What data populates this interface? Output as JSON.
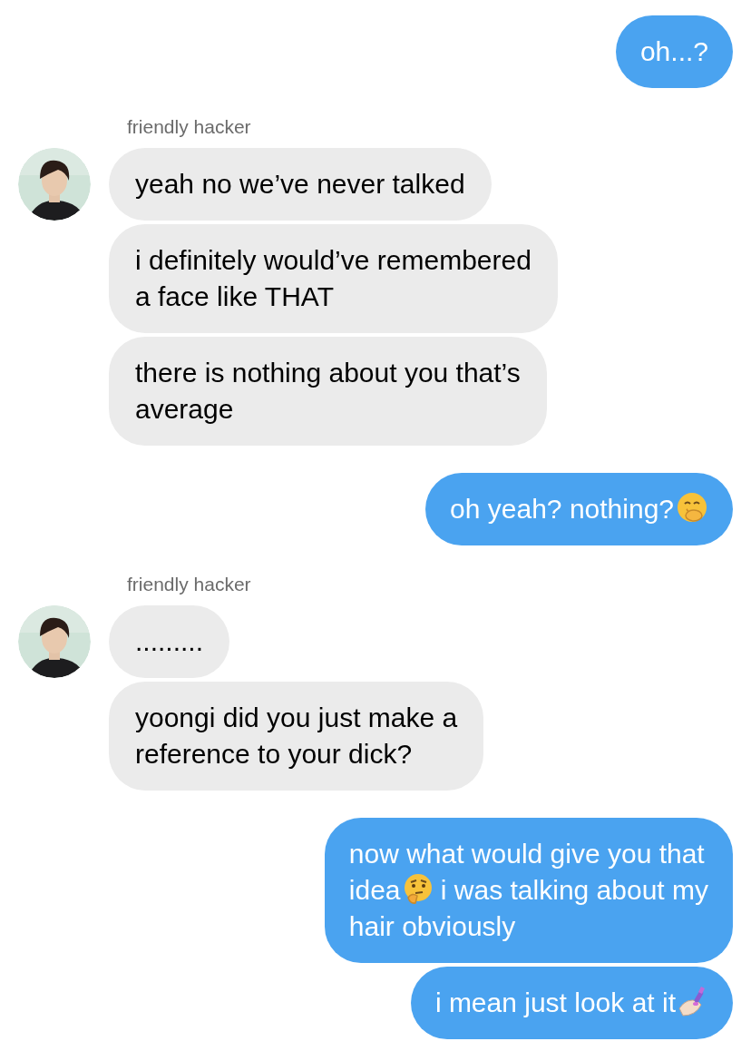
{
  "groups": [
    {
      "kind": "sent",
      "messages": [
        {
          "lines": [
            [
              {
                "kind": "text",
                "text": "oh...?"
              }
            ]
          ]
        }
      ]
    },
    {
      "kind": "received",
      "name": "friendly hacker",
      "avatar": {
        "kind": "picture"
      },
      "messages": [
        {
          "lines": [
            [
              {
                "kind": "text",
                "text": "yeah no we’ve never talked"
              }
            ]
          ]
        },
        {
          "lines": [
            [
              {
                "kind": "text",
                "text": "i definitely would’ve remembered"
              }
            ],
            [
              {
                "kind": "text",
                "text": "a face like THAT"
              }
            ]
          ]
        },
        {
          "lines": [
            [
              {
                "kind": "text",
                "text": "there is nothing about you that’s"
              }
            ],
            [
              {
                "kind": "text",
                "text": "average"
              }
            ]
          ]
        }
      ]
    },
    {
      "kind": "sent",
      "messages": [
        {
          "lines": [
            [
              {
                "kind": "text",
                "text": "oh yeah? nothing?"
              },
              {
                "kind": "giggle"
              }
            ]
          ]
        }
      ]
    },
    {
      "kind": "received",
      "name": "friendly hacker",
      "avatar": {
        "kind": "picture"
      },
      "messages": [
        {
          "lines": [
            [
              {
                "kind": "text",
                "text": "........."
              }
            ]
          ]
        },
        {
          "lines": [
            [
              {
                "kind": "text",
                "text": "yoongi did you just make a"
              }
            ],
            [
              {
                "kind": "text",
                "text": "reference to your dick?"
              }
            ]
          ]
        }
      ]
    },
    {
      "kind": "sent",
      "messages": [
        {
          "lines": [
            [
              {
                "kind": "text",
                "text": "now what would give you that"
              }
            ],
            [
              {
                "kind": "text",
                "text": "idea"
              },
              {
                "kind": "thinking"
              },
              {
                "kind": "text",
                "text": " i was talking about my"
              }
            ],
            [
              {
                "kind": "text",
                "text": "hair obviously"
              }
            ]
          ]
        },
        {
          "lines": [
            [
              {
                "kind": "text",
                "text": "i mean just look at it"
              },
              {
                "kind": "nails"
              }
            ]
          ]
        }
      ]
    }
  ]
}
